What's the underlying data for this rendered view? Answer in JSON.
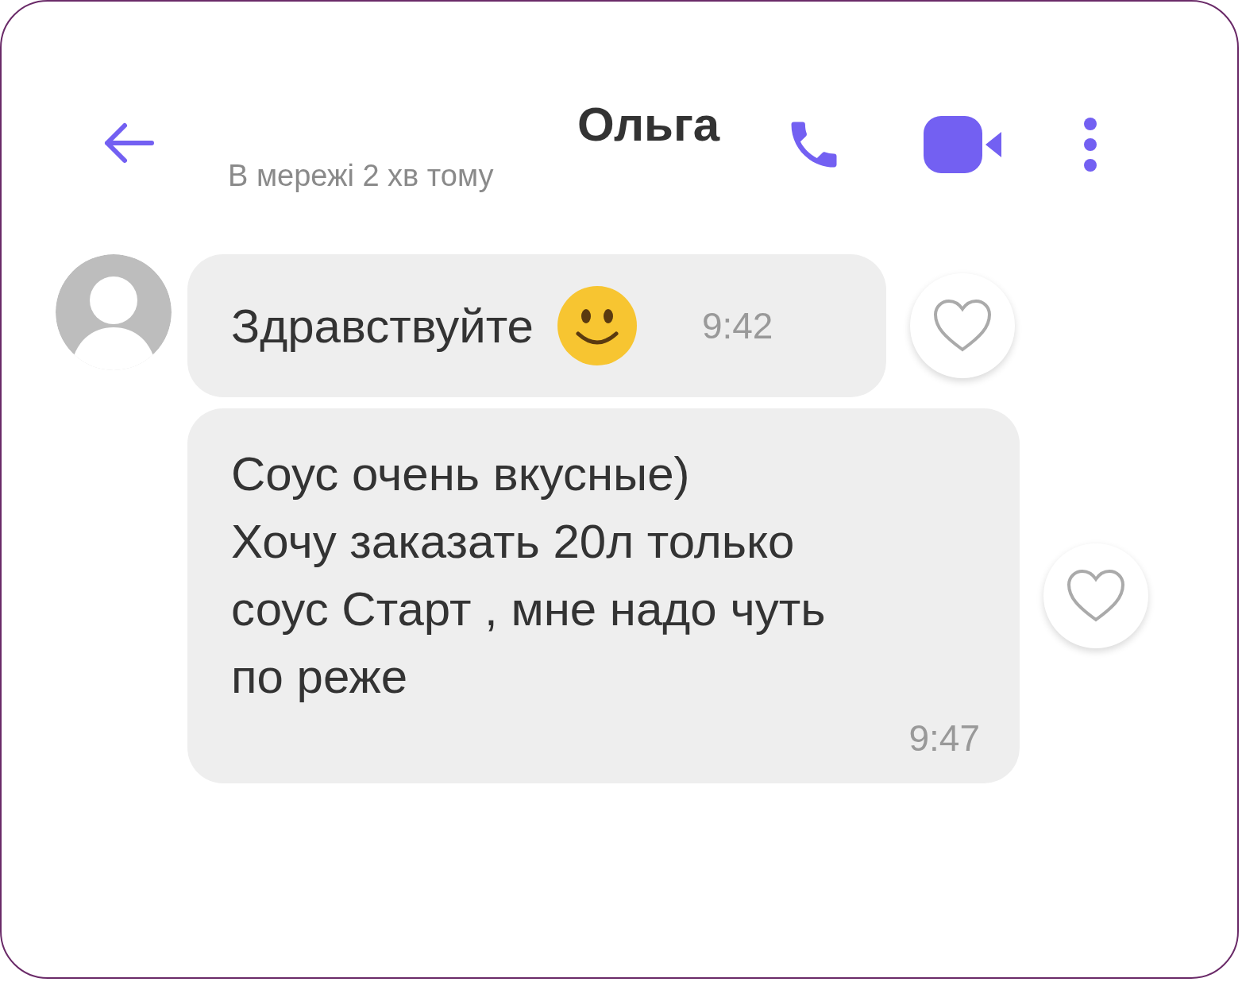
{
  "header": {
    "title": "Ольга",
    "status": "В мережі 2 хв тому"
  },
  "messages": [
    {
      "kind": "emoji",
      "text": "Здравствуйте",
      "time": "9:42",
      "liked": false
    },
    {
      "kind": "text",
      "text": "Соус очень вкусные)\nХочу заказать 20л только\nсоус Старт , мне надо чуть\nпо реже",
      "time": "9:47",
      "liked": false
    }
  ]
}
